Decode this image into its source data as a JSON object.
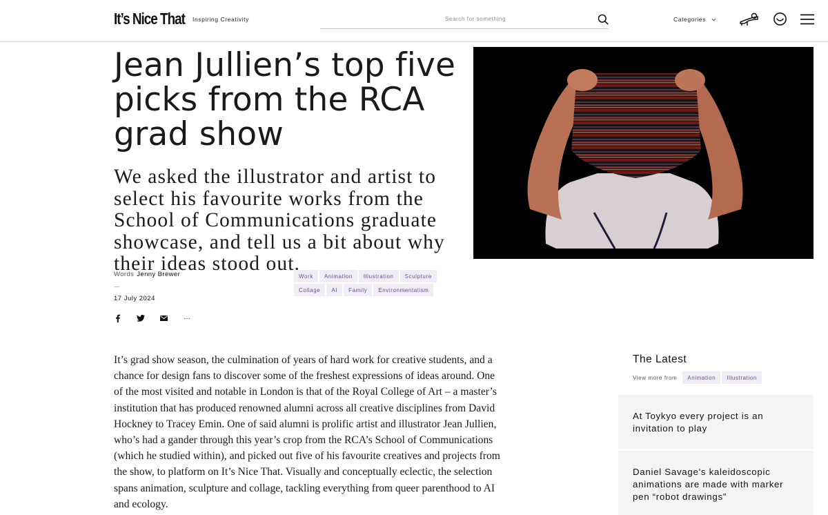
{
  "header": {
    "logo": "It’s Nice That",
    "tagline": "Inspiring Creativity",
    "search_placeholder": "Search for something",
    "categories_label": "Categories"
  },
  "article": {
    "title": "Jean Jullien’s top five picks from the RCA grad show",
    "standfirst": "We asked the illustrator and artist to select his favourite works from the School of Communications graduate showcase, and tell us a bit about why their ideas stood out.",
    "words_label": "Words",
    "author": "Jenny Brewer",
    "date": "17 July 2024",
    "share_icons": [
      "facebook-icon",
      "twitter-icon",
      "email-icon",
      "more-icon"
    ],
    "more_label": "···",
    "tags_row1": [
      "Work",
      "Animation",
      "Illustration",
      "Sculpture"
    ],
    "tags_row2": [
      "Collage",
      "AI",
      "Family",
      "Environmentalism"
    ],
    "body": "It’s grad show season, the culmination of years of hard work for creative students, and a chance for design fans to discover some of the freshest expressions of ideas around. One of the most visited and notable in London is that of the Royal College of Art – a master’s institution that has produced renowned alumni across all creative disciplines from David Hockney to Tracey Emin. One of said alumni is prolific artist and illustrator Jean Jullien, who’s had a gander through this year’s crop from the RCA’s School of Communications (which he studied within), and picked out five of his favourite creatives and projects from the show, to platform on It’s Nice That. Visually and conceptually eclectic, the selection spans animation, sculpture and collage, tackling everything from queer parenthood to AI and ecology."
  },
  "sidebar": {
    "title": "The Latest",
    "view_more_label": "View more from",
    "view_more_tags": [
      "Animation",
      "Illustration"
    ],
    "cards": [
      {
        "title": "At Toykyo every project is an invitation to play"
      },
      {
        "title": "Daniel Savage's kaleidoscopic animations are made with marker pen “robot drawings”"
      }
    ]
  },
  "colors": {
    "tag_bg": "#f1edf4",
    "tag_text": "#6b4ea0",
    "card_bg": "#f4f4f4",
    "hero_bg": "#000000"
  }
}
